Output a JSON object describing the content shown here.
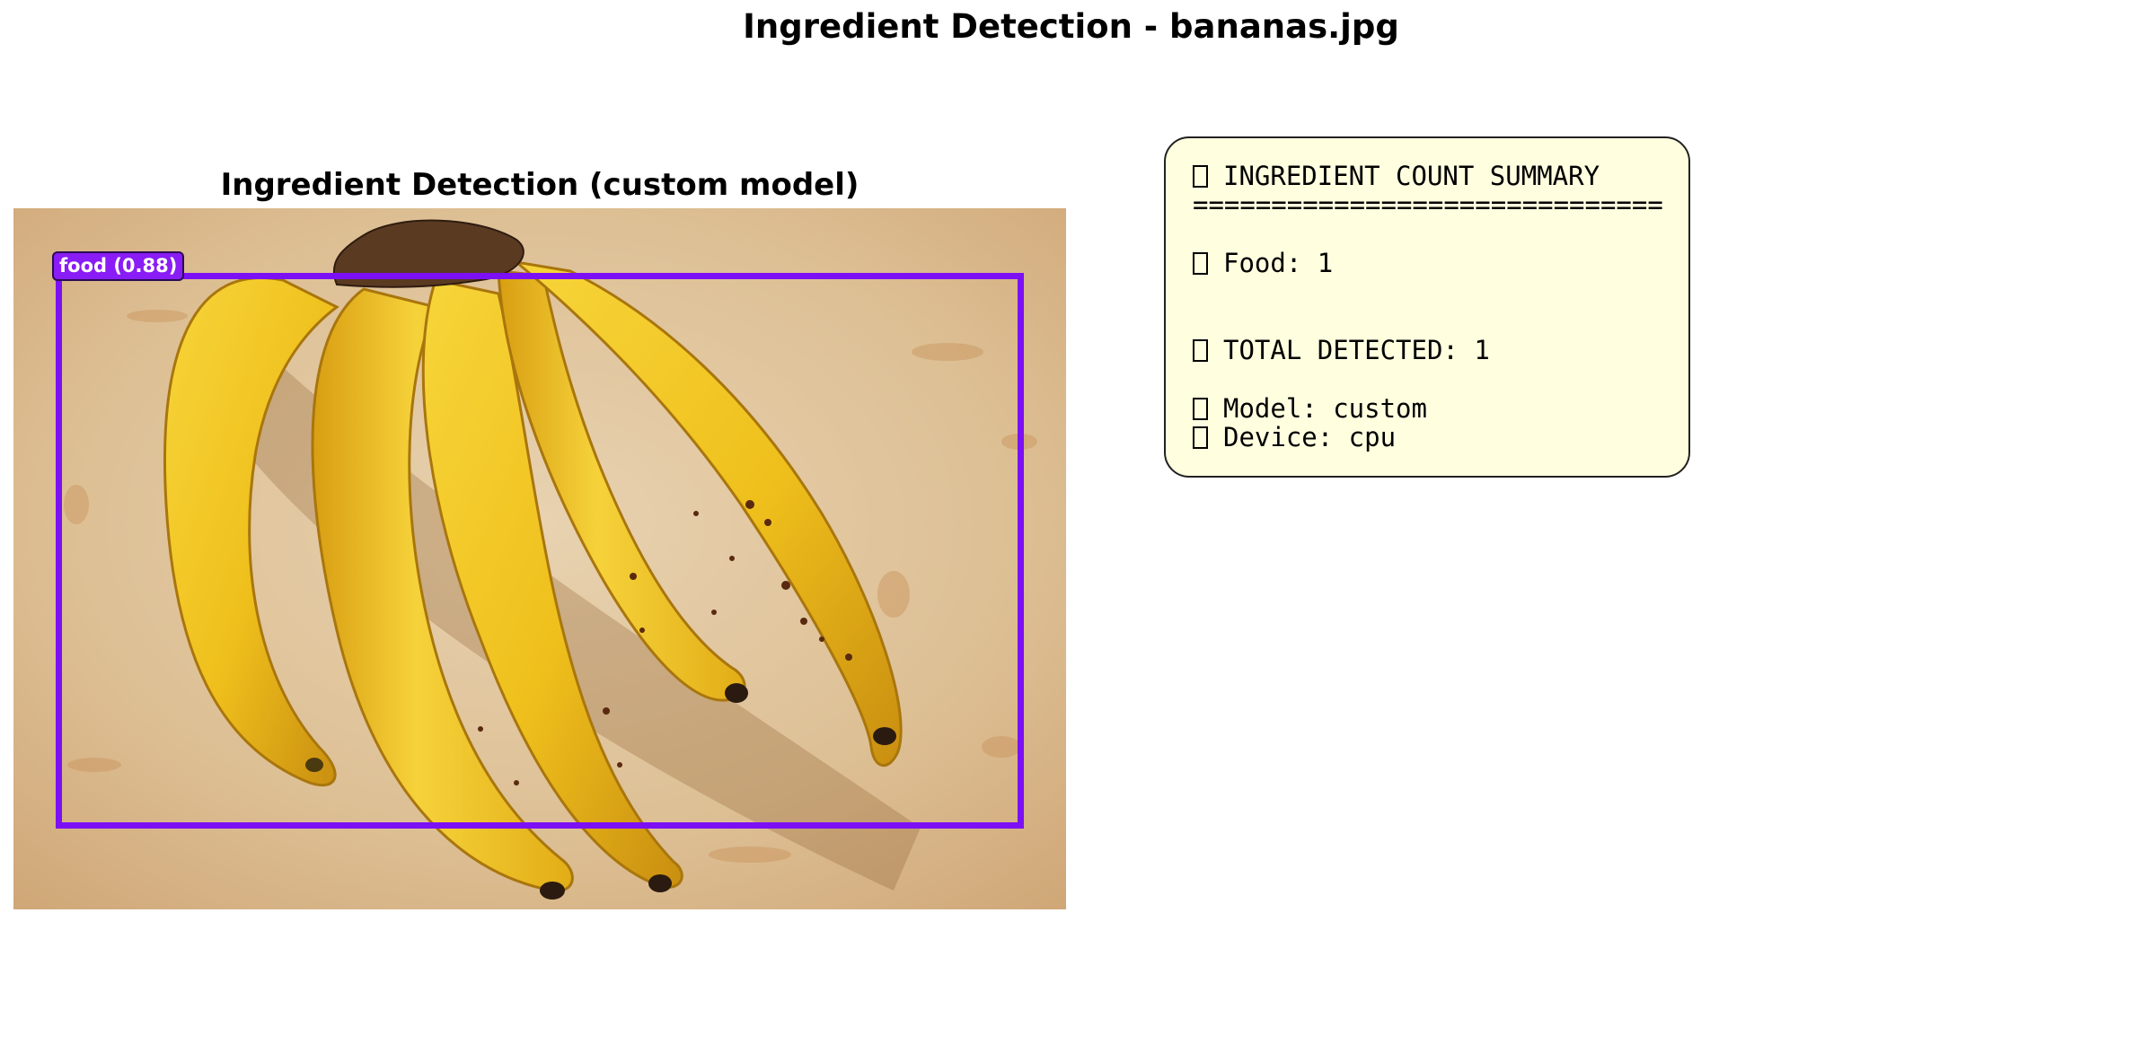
{
  "figure": {
    "title": "Ingredient Detection - bananas.jpg"
  },
  "detection_panel": {
    "title": "Ingredient Detection (custom model)",
    "image_file": "bananas.jpg",
    "detections": [
      {
        "label": "food (0.88)",
        "class": "food",
        "confidence": 0.88,
        "box_color": "#7c10f4"
      }
    ]
  },
  "summary": {
    "background_color": "#ffffe0",
    "header": "INGREDIENT COUNT SUMMARY",
    "separator": "==============================",
    "count_line": "Food: 1",
    "total_line": "TOTAL DETECTED: 1",
    "model_line": "Model: custom",
    "device_line": "Device: cpu",
    "missing_glyph_icon": "missing-glyph-box"
  },
  "colors": {
    "accent": "#7c10f4",
    "label_background": "#8a1cf5",
    "banana_yellow": "#f2c21a",
    "countertop": "#e2c6a0"
  }
}
